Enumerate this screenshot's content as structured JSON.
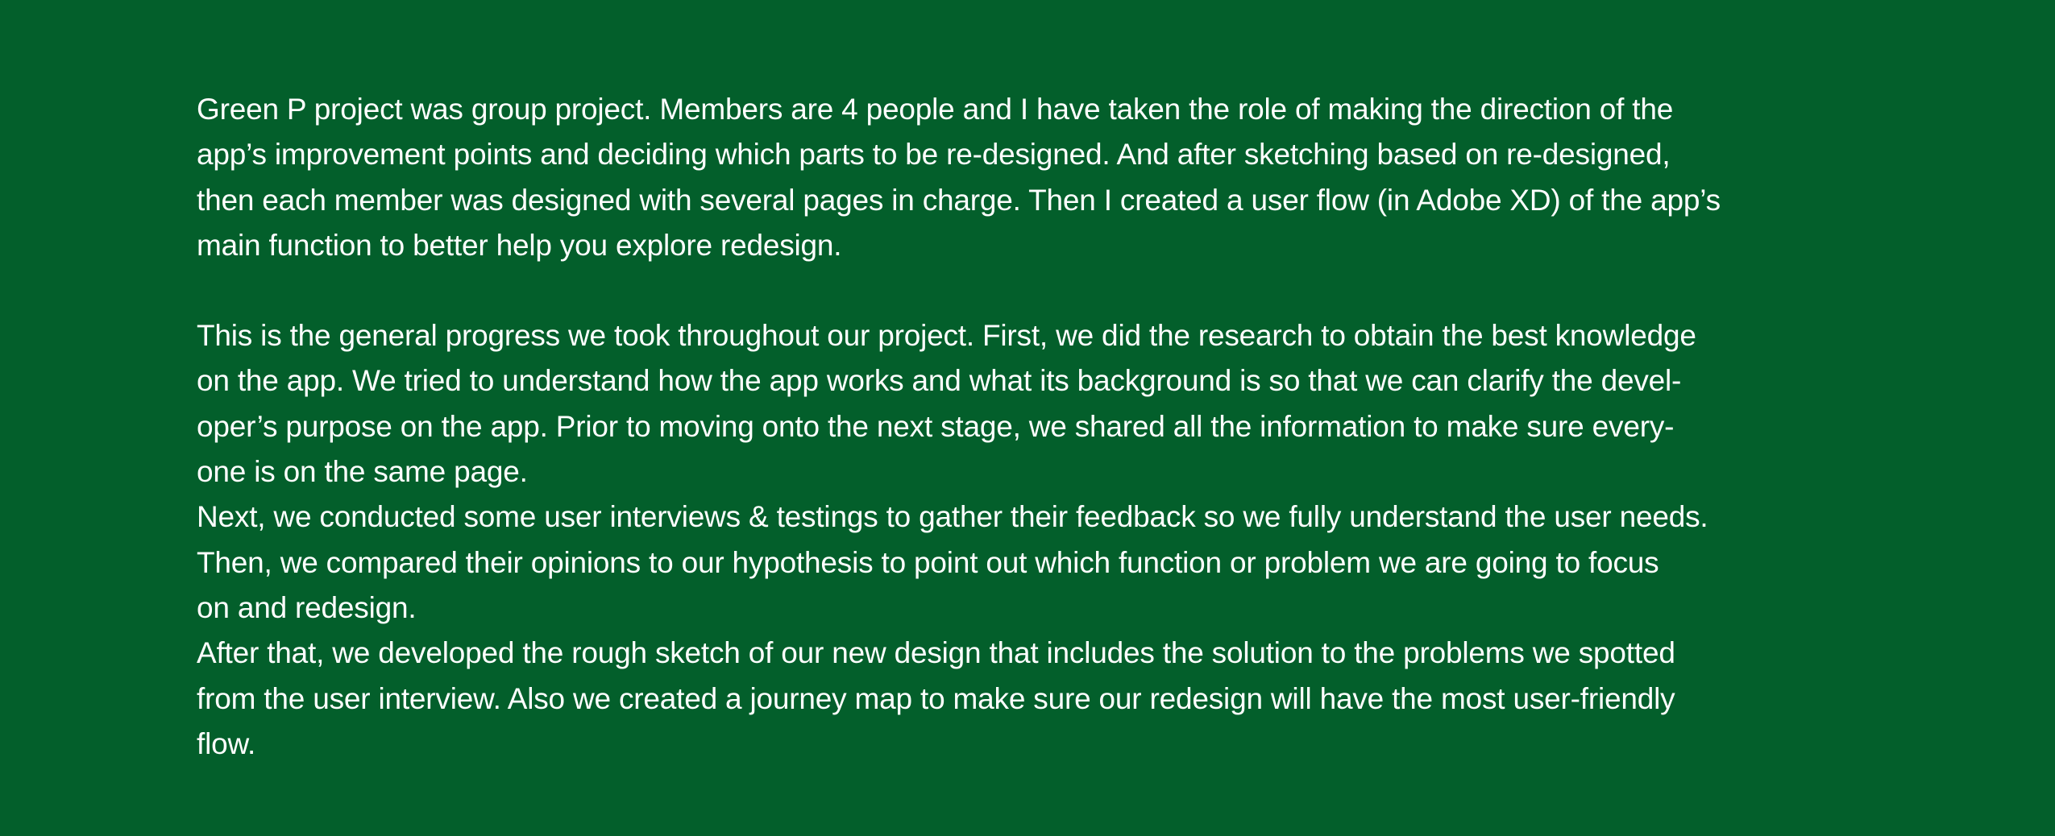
{
  "paragraphs": [
    {
      "lines": [
        "Green P project was group project. Members are 4 people and I have taken the role of making the direction of the",
        "app’s improvement points and deciding which parts to be re-designed. And after sketching based on re-designed,",
        "then each member was designed with several pages in charge. Then I created a user flow (in Adobe XD) of the app’s",
        "main function to better help you explore redesign."
      ]
    },
    {
      "lines": [
        "This is the general progress we took throughout our project. First, we did the research to obtain the best knowledge",
        "on the app. We tried to understand how the app works and what its background is so that we can clarify the devel-",
        "oper’s purpose on the app. Prior to moving onto the next stage, we shared all the information to make sure every-",
        "one is on the same page.",
        "Next, we conducted some user interviews & testings to gather their feedback so we fully understand the user needs.",
        "Then, we compared their opinions to our hypothesis to point out which function or problem we are going to focus",
        "on and redesign.",
        "After that, we developed the rough sketch of our new design that includes the solution to the problems we spotted",
        "from the user interview. Also we created a journey map to make sure our redesign will have the most user-friendly",
        "flow."
      ]
    }
  ]
}
